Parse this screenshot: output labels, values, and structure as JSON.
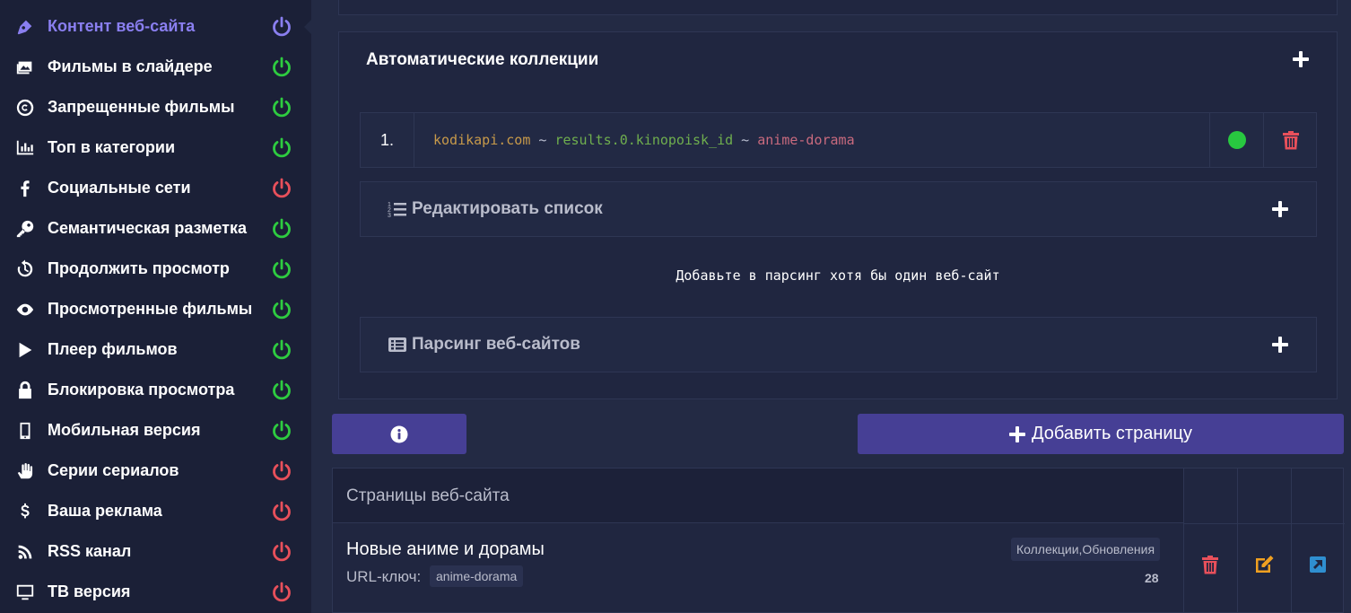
{
  "sidebar": {
    "items": [
      {
        "label": "Контент веб-сайта",
        "icon": "pen-nib-icon",
        "power": "on",
        "active": true
      },
      {
        "label": "Фильмы в слайдере",
        "icon": "images-icon",
        "power": "on"
      },
      {
        "label": "Запрещенные фильмы",
        "icon": "copyright-icon",
        "power": "on"
      },
      {
        "label": "Топ в категории",
        "icon": "bar-chart-icon",
        "power": "on"
      },
      {
        "label": "Социальные сети",
        "icon": "facebook-icon",
        "power": "off"
      },
      {
        "label": "Семантическая разметка",
        "icon": "key-icon",
        "power": "on"
      },
      {
        "label": "Продолжить просмотр",
        "icon": "history-icon",
        "power": "on"
      },
      {
        "label": "Просмотренные фильмы",
        "icon": "eye-icon",
        "power": "on"
      },
      {
        "label": "Плеер фильмов",
        "icon": "play-icon",
        "power": "on"
      },
      {
        "label": "Блокировка просмотра",
        "icon": "lock-icon",
        "power": "on"
      },
      {
        "label": "Мобильная версия",
        "icon": "mobile-icon",
        "power": "on"
      },
      {
        "label": "Серии сериалов",
        "icon": "hand-icon",
        "power": "off"
      },
      {
        "label": "Ваша реклама",
        "icon": "dollar-icon",
        "power": "off"
      },
      {
        "label": "RSS канал",
        "icon": "rss-icon",
        "power": "off"
      },
      {
        "label": "ТВ версия",
        "icon": "tv-icon",
        "power": "off"
      }
    ]
  },
  "colors": {
    "power_on": "#2ecc40",
    "power_off": "#e8505b",
    "power_active": "#8a7ff0",
    "accent": "#463f95"
  },
  "auto_collections": {
    "title": "Автоматические коллекции",
    "row": {
      "number": "1.",
      "site": "kodikapi.com",
      "sep1": " ~ ",
      "path": "results.0.kinopoisk_id",
      "sep2": " ~ ",
      "key": "anime-dorama",
      "status": "active"
    },
    "edit_list_label": "Редактировать список",
    "hint": "Добавьте в парсинг хотя бы один веб-сайт",
    "parsing_label": "Парсинг веб-сайтов"
  },
  "buttons": {
    "add_page": "Добавить страницу"
  },
  "pages_table": {
    "header": "Страницы веб-сайта",
    "rows": [
      {
        "name": "Новые аниме и дорамы",
        "url_label": "URL-ключ:",
        "url_key": "anime-dorama",
        "tags": "Коллекции,Обновления",
        "count": "28"
      }
    ]
  }
}
